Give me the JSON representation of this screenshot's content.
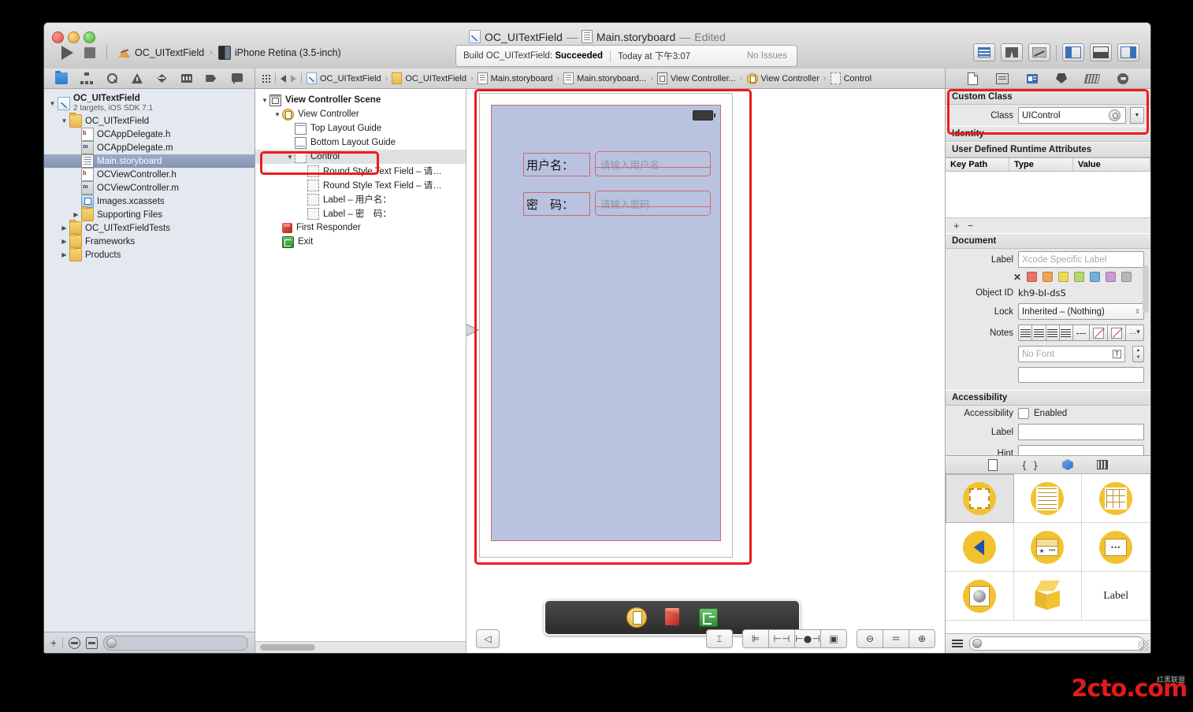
{
  "window": {
    "title_project": "OC_UITextField",
    "title_sep1": "—",
    "title_file": "Main.storyboard",
    "title_sep2": "—",
    "title_edited": "Edited"
  },
  "toolbar": {
    "run_label": "Run",
    "stop_label": "Stop",
    "scheme_project": "OC_UITextField",
    "scheme_chevron": "›",
    "scheme_device": "iPhone Retina (3.5-inch)",
    "status_build": "Build OC_UITextField:",
    "status_result": "Succeeded",
    "status_time": "Today at 下午3:07",
    "status_issues": "No Issues",
    "view_buttons": [
      "standard-editor",
      "assistant-editor",
      "version-editor",
      "toggle-navigator",
      "toggle-debug-area",
      "toggle-utilities"
    ]
  },
  "navigator": {
    "toolbar_icons": [
      "project-navigator-icon",
      "symbol-navigator-icon",
      "search-navigator-icon",
      "issue-navigator-icon",
      "test-navigator-icon",
      "debug-navigator-icon",
      "breakpoint-navigator-icon",
      "report-navigator-icon"
    ],
    "tree": [
      {
        "label": "OC_UITextField",
        "sub": "2 targets, iOS SDK 7.1",
        "indent": 0,
        "disc": "▼",
        "icon": "project",
        "selected": false,
        "twoline": true
      },
      {
        "label": "OC_UITextField",
        "sub": "",
        "indent": 1,
        "disc": "▼",
        "icon": "folder",
        "selected": false,
        "twoline": false
      },
      {
        "label": "OCAppDelegate.h",
        "sub": "",
        "indent": 2,
        "disc": "",
        "icon": "h",
        "selected": false,
        "twoline": false
      },
      {
        "label": "OCAppDelegate.m",
        "sub": "",
        "indent": 2,
        "disc": "",
        "icon": "m",
        "selected": false,
        "twoline": false
      },
      {
        "label": "Main.storyboard",
        "sub": "",
        "indent": 2,
        "disc": "",
        "icon": "storyboard",
        "selected": true,
        "twoline": false
      },
      {
        "label": "OCViewController.h",
        "sub": "",
        "indent": 2,
        "disc": "",
        "icon": "h",
        "selected": false,
        "twoline": false
      },
      {
        "label": "OCViewController.m",
        "sub": "",
        "indent": 2,
        "disc": "",
        "icon": "m",
        "selected": false,
        "twoline": false
      },
      {
        "label": "Images.xcassets",
        "sub": "",
        "indent": 2,
        "disc": "",
        "icon": "xcassets",
        "selected": false,
        "twoline": false
      },
      {
        "label": "Supporting Files",
        "sub": "",
        "indent": 2,
        "disc": "▶",
        "icon": "folder",
        "selected": false,
        "twoline": false
      },
      {
        "label": "OC_UITextFieldTests",
        "sub": "",
        "indent": 1,
        "disc": "▶",
        "icon": "folder",
        "selected": false,
        "twoline": false
      },
      {
        "label": "Frameworks",
        "sub": "",
        "indent": 1,
        "disc": "▶",
        "icon": "folder",
        "selected": false,
        "twoline": false
      },
      {
        "label": "Products",
        "sub": "",
        "indent": 1,
        "disc": "▶",
        "icon": "folder",
        "selected": false,
        "twoline": false
      }
    ],
    "filter_plus": "+",
    "filter_placeholder": ""
  },
  "jump_bar": {
    "crumbs": [
      {
        "label": "OC_UITextField",
        "icon": "project"
      },
      {
        "label": "OC_UITextField",
        "icon": "folder"
      },
      {
        "label": "Main.storyboard",
        "icon": "storyboard"
      },
      {
        "label": "Main.storyboard...",
        "icon": "storyboard"
      },
      {
        "label": "View Controller...",
        "icon": "scene"
      },
      {
        "label": "View Controller",
        "icon": "viewcontroller"
      },
      {
        "label": "Control",
        "icon": "control"
      }
    ],
    "separator": "›"
  },
  "outline": [
    {
      "label": "View Controller Scene",
      "indent": 0,
      "disc": "▼",
      "icon": "scene",
      "bold": true,
      "highlighted": false
    },
    {
      "label": "View Controller",
      "indent": 1,
      "disc": "▼",
      "icon": "viewcontroller",
      "bold": false,
      "highlighted": false
    },
    {
      "label": "Top Layout Guide",
      "indent": 2,
      "disc": "",
      "icon": "guide-top",
      "bold": false,
      "highlighted": false
    },
    {
      "label": "Bottom Layout Guide",
      "indent": 2,
      "disc": "",
      "icon": "guide-bottom",
      "bold": false,
      "highlighted": false
    },
    {
      "label": "Control",
      "indent": 2,
      "disc": "▼",
      "icon": "control",
      "bold": false,
      "highlighted": true
    },
    {
      "label": "Round Style Text Field – 请…",
      "indent": 3,
      "disc": "",
      "icon": "control",
      "bold": false,
      "highlighted": false
    },
    {
      "label": "Round Style Text Field – 请…",
      "indent": 3,
      "disc": "",
      "icon": "control",
      "bold": false,
      "highlighted": false
    },
    {
      "label": "Label – 用户名：",
      "indent": 3,
      "disc": "",
      "icon": "control",
      "bold": false,
      "highlighted": false
    },
    {
      "label": "Label – 密　码：",
      "indent": 3,
      "disc": "",
      "icon": "control",
      "bold": false,
      "highlighted": false
    },
    {
      "label": "First Responder",
      "indent": 1,
      "disc": "",
      "icon": "first-responder",
      "bold": false,
      "highlighted": false
    },
    {
      "label": "Exit",
      "indent": 1,
      "disc": "",
      "icon": "exit",
      "bold": false,
      "highlighted": false
    }
  ],
  "canvas": {
    "label_username": "用户名：",
    "label_password": "密　码：",
    "placeholder_username": "请输入用户名",
    "placeholder_password": "请输入密码",
    "dock_items": [
      "view-controller",
      "first-responder",
      "exit"
    ],
    "bottom_buttons": [
      "toggle-document-outline",
      "constraints-resolve",
      "align",
      "pin",
      "resolve-issues",
      "resizing",
      "zoom-out",
      "zoom-actual",
      "zoom-in"
    ]
  },
  "inspector": {
    "tabs": [
      "file-inspector-icon",
      "quick-help-icon",
      "identity-inspector-icon",
      "attributes-inspector-icon",
      "size-inspector-icon",
      "connections-inspector-icon"
    ],
    "custom_class": {
      "title": "Custom Class",
      "class_label": "Class",
      "class_value": "UIControl"
    },
    "identity": {
      "title": "Identity"
    },
    "runtime": {
      "title": "User Defined Runtime Attributes",
      "columns": [
        "Key Path",
        "Type",
        "Value"
      ],
      "rows": [],
      "add": "+",
      "remove": "−"
    },
    "document": {
      "title": "Document",
      "label_label": "Label",
      "label_placeholder": "Xcode Specific Label",
      "swatch_clear": "✕",
      "swatches": [
        "#e8726a",
        "#efa555",
        "#eed757",
        "#b7d86a",
        "#6fb0e0",
        "#c89ad8",
        "#b6b6b6"
      ],
      "object_id_label": "Object ID",
      "object_id_value": "kh9-bI-dsS",
      "lock_label": "Lock",
      "lock_value": "Inherited – (Nothing)",
      "notes_label": "Notes",
      "font_value": "No Font",
      "note_text": ""
    },
    "accessibility": {
      "title": "Accessibility",
      "row_label": "Accessibility",
      "enabled_label": "Enabled",
      "enabled_checked": false,
      "label_label": "Label",
      "label_value": "",
      "hint_label": "Hint",
      "hint_value": ""
    }
  },
  "library": {
    "tabs": [
      "file-template-library-icon",
      "code-snippet-library-icon",
      "object-library-icon",
      "media-library-icon"
    ],
    "items": [
      {
        "name": "view-object",
        "kind": "dashed-box",
        "label": "",
        "selected": true
      },
      {
        "name": "table-view-object",
        "kind": "lines-box",
        "label": "",
        "selected": false
      },
      {
        "name": "collection-view-object",
        "kind": "grid-box",
        "label": "",
        "selected": false
      },
      {
        "name": "back-button-object",
        "kind": "chevron",
        "label": "",
        "selected": false
      },
      {
        "name": "navigation-bar-object",
        "kind": "nav-bar",
        "label": "",
        "selected": false
      },
      {
        "name": "toolbar-object",
        "kind": "dots-box",
        "label": "",
        "selected": false
      },
      {
        "name": "image-view-object",
        "kind": "sphere-box",
        "label": "",
        "selected": false
      },
      {
        "name": "object-cube",
        "kind": "cube",
        "label": "",
        "selected": false
      },
      {
        "name": "label-object",
        "kind": "text",
        "label": "Label",
        "selected": false
      }
    ],
    "filter_placeholder": ""
  },
  "watermark": {
    "text": "2cto",
    "suffix": ".com",
    "sub": "红黑联盟"
  }
}
